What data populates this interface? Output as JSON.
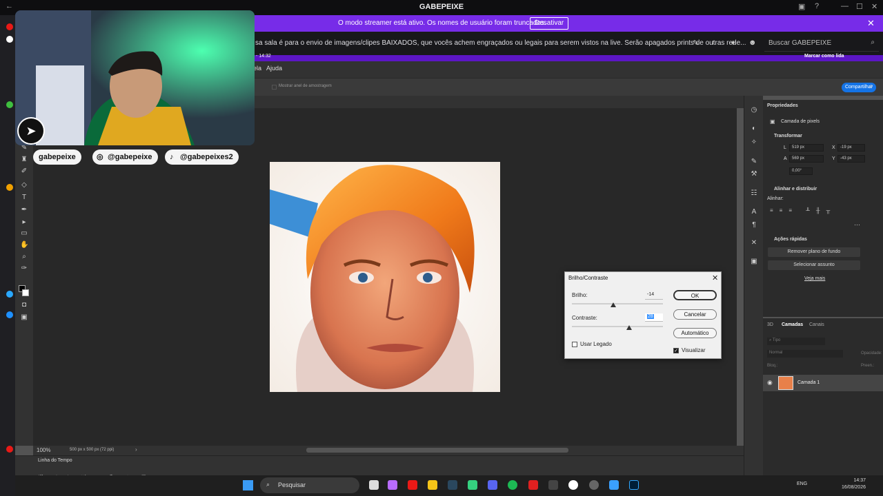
{
  "twitch": {
    "window_title": "GABEPEIXE",
    "banner_message": "O modo streamer está ativo. Os nomes de usuário foram truncados.",
    "banner_button": "Desativar",
    "chat_info": "sa sala é para o envio de imagens/clipes BAIXADOS, que vocês achem engraçados ou legais para serem vistos na live. Serão apagados prints de outras rede...",
    "search_placeholder": "Buscar GABEPEIXE",
    "strip_left": "- 14:32",
    "strip_right": "Marcar como lida"
  },
  "overlay": {
    "socials": [
      "gabepeixe",
      "@gabepeixe",
      "@gabepeixes2"
    ]
  },
  "photoshop": {
    "menu": [
      "ela",
      "Ajuda"
    ],
    "option_hint": "Mostrar anel de amostragem",
    "share_button": "Compartilhar",
    "zoom": "100%",
    "doc_info": "500 px x 500 px (72 ppi)",
    "timeline_title": "Linha do Tempo",
    "properties": {
      "title": "Propriedades",
      "layer_type": "Camada de pixels",
      "transform_title": "Transformar",
      "w_label": "L",
      "w_value": "519 px",
      "h_label": "A",
      "h_value": "569 px",
      "x_label": "X",
      "x_value": "-19 px",
      "y_label": "Y",
      "y_value": "-43 px",
      "angle": "0,00°",
      "align_title": "Alinhar e distribuir",
      "align_label": "Alinhar:",
      "quick_title": "Ações rápidas",
      "remove_bg": "Remover plano de fundo",
      "select_subject": "Selecionar assunto",
      "more": "Veja mais"
    },
    "layers": {
      "tabs": [
        "3D",
        "Camadas",
        "Canais"
      ],
      "search_placeholder": "Tipo",
      "blend_mode": "Normal",
      "opacity_label": "Opacidade:",
      "lock_label": "Bloq.:",
      "fill_label": "Preen.:",
      "layer_name": "Camada 1"
    },
    "dialog": {
      "title": "Brilho/Contraste",
      "brightness_label": "Brilho:",
      "brightness_value": "-14",
      "contrast_label": "Contraste:",
      "contrast_value": "28",
      "legacy_label": "Usar Legado",
      "preview_label": "Visualizar",
      "ok": "OK",
      "cancel": "Cancelar",
      "auto": "Automático"
    }
  },
  "taskbar": {
    "search": "Pesquisar",
    "lang": "ENG",
    "time": "14:37",
    "date": "16/08/2026"
  },
  "colors": {
    "twitch_purple": "#772ce8",
    "ps_blue": "#1473e6",
    "canvas_bg": "#282828"
  }
}
